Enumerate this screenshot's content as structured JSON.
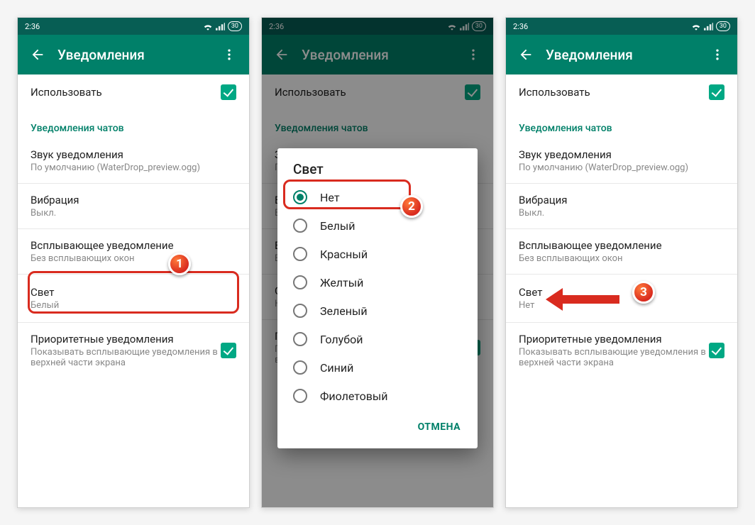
{
  "status": {
    "time": "2:36",
    "battery": "30"
  },
  "appbar": {
    "title": "Уведомления"
  },
  "sections": {
    "use_label": "Использовать",
    "chat_header": "Уведомления чатов",
    "sound_title": "Звук уведомления",
    "sound_sub": "По умолчанию (WaterDrop_preview.ogg)",
    "vibration_title": "Вибрация",
    "vibration_sub": "Выкл.",
    "popup_title": "Всплывающее уведомление",
    "popup_sub": "Без всплывающих окон",
    "light_title": "Свет",
    "light_sub_screen1": "Белый",
    "light_sub_screen3": "Нет",
    "priority_title": "Приоритетные уведомления",
    "priority_sub": "Показывать всплывающие уведомления в верхней части экрана"
  },
  "dialog": {
    "title": "Свет",
    "options": [
      "Нет",
      "Белый",
      "Красный",
      "Желтый",
      "Зеленый",
      "Голубой",
      "Синий",
      "Фиолетовый"
    ],
    "selected_index": 0,
    "cancel": "ОТМЕНА"
  },
  "badges": {
    "one": "1",
    "two": "2",
    "three": "3"
  }
}
